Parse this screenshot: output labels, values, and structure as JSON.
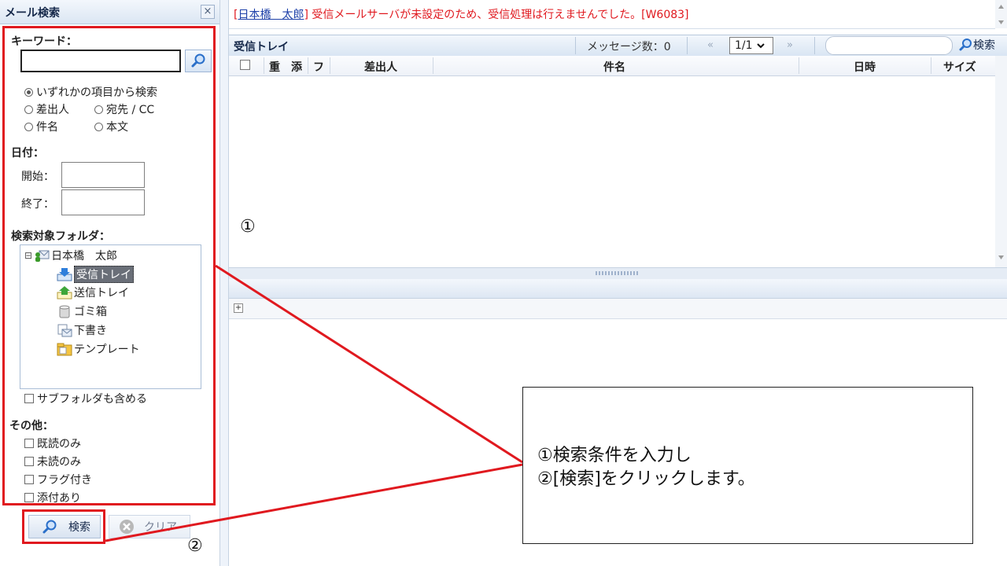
{
  "left_panel": {
    "title": "メール検索",
    "close_label": "×",
    "keyword_label": "キーワード：",
    "keyword_value": "",
    "radios": [
      {
        "label": "いずれかの項目から検索",
        "checked": true
      },
      {
        "label": "差出人",
        "checked": false
      },
      {
        "label": "宛先 / CC",
        "checked": false
      },
      {
        "label": "件名",
        "checked": false
      },
      {
        "label": "本文",
        "checked": false
      }
    ],
    "date_label": "日付：",
    "start_label": "開始：",
    "end_label": "終了：",
    "folder_label": "検索対象フォルダ：",
    "tree_toggle": "⊟",
    "folders": {
      "root": "日本橋　太郎",
      "inbox": "受信トレイ",
      "sent": "送信トレイ",
      "trash": "ゴミ箱",
      "draft": "下書き",
      "template": "テンプレート"
    },
    "include_subfolders": "サブフォルダも含める",
    "other_label": "その他：",
    "others": [
      "既読のみ",
      "未読のみ",
      "フラグ付き",
      "添付あり"
    ],
    "search_button": "検索",
    "clear_button": "クリア"
  },
  "notice": {
    "open_bracket": "[",
    "user_link": "日本橋　太郎",
    "message": "] 受信メールサーバが未設定のため、受信処理は行えませんでした。[W6083]"
  },
  "inbox": {
    "title": "受信トレイ",
    "message_count": "メッセージ数：0",
    "prev": "«",
    "page": "1/1",
    "next": "»",
    "search_placeholder": "",
    "search_button": "検索",
    "columns": [
      "重",
      "添",
      "フ",
      "差出人",
      "件名",
      "日時",
      "サイズ"
    ]
  },
  "annotations": {
    "marker1": "①",
    "marker2": "②",
    "callout_line1": "①検索条件を入力し",
    "callout_line2": "②[検索]をクリックします。"
  },
  "colors": {
    "highlight": "#e0191f",
    "header_text": "#15284a",
    "link": "#1c3fa8"
  }
}
